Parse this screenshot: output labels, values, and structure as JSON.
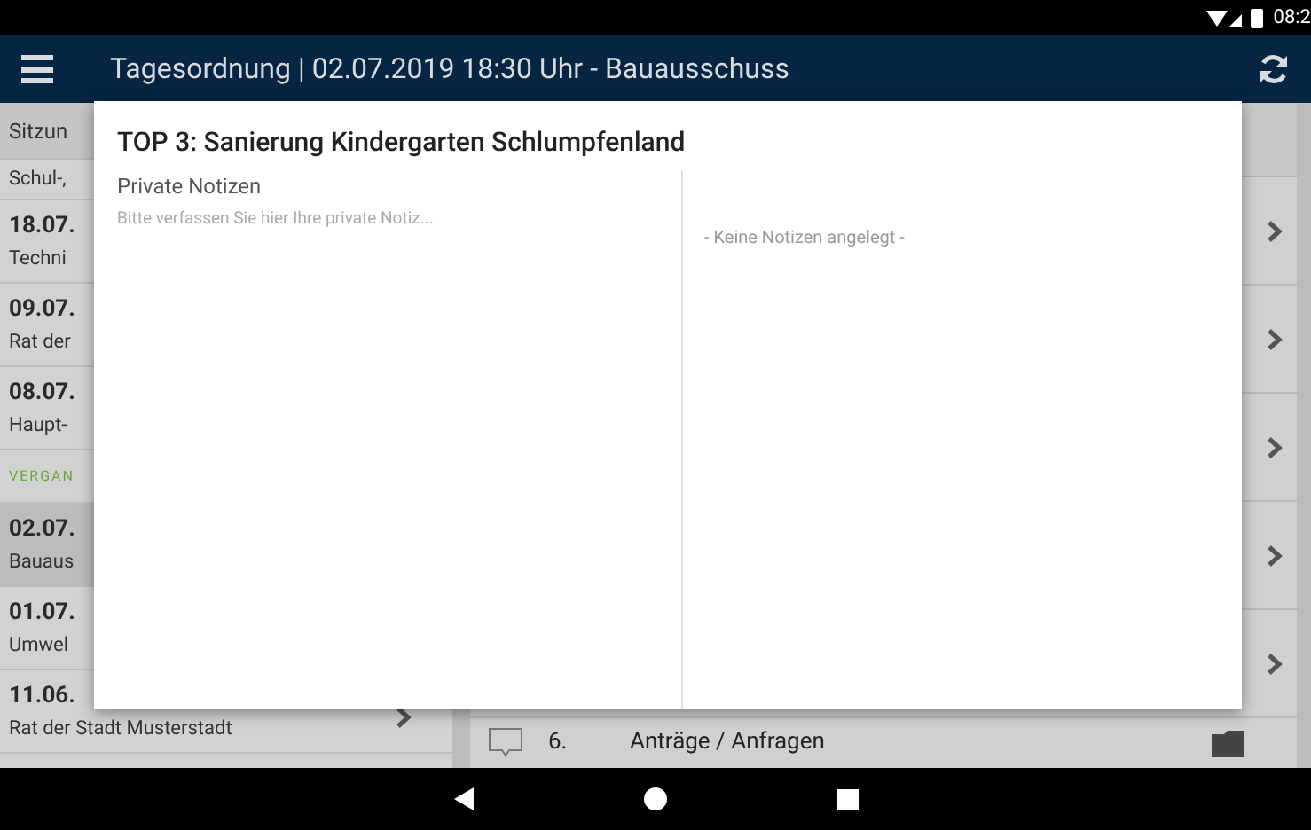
{
  "status_bar": {
    "time": "08:2"
  },
  "app_bar": {
    "title": "Tagesordnung | 02.07.2019 18:30 Uhr - Bauausschuss"
  },
  "sidebar": {
    "header": "Sitzun",
    "items": [
      {
        "kind": "partial",
        "subtitle": "Schul-,",
        "selected": false
      },
      {
        "kind": "meeting",
        "date": "18.07.",
        "subtitle": "Techni",
        "selected": false
      },
      {
        "kind": "meeting",
        "date": "09.07.",
        "subtitle": "Rat der",
        "selected": false
      },
      {
        "kind": "meeting",
        "date": "08.07.",
        "subtitle": "Haupt-",
        "selected": false
      },
      {
        "kind": "section",
        "label": "VERGAN"
      },
      {
        "kind": "meeting",
        "date": "02.07.",
        "subtitle": "Bauaus",
        "selected": true
      },
      {
        "kind": "meeting",
        "date": "01.07.",
        "subtitle": "Umwel",
        "selected": false
      },
      {
        "kind": "meeting",
        "date": "11.06.",
        "subtitle": "Rat der Stadt Musterstadt",
        "selected": false,
        "chevron": true
      }
    ]
  },
  "agenda": {
    "last_row": {
      "number": "6.",
      "title": "Anträge / Anfragen"
    }
  },
  "dialog": {
    "title": "TOP 3: Sanierung Kindergarten Schlumpfenland",
    "notes_label": "Private Notizen",
    "placeholder": "Bitte verfassen Sie hier Ihre private Notiz...",
    "empty_text": "- Keine Notizen angelegt -"
  }
}
